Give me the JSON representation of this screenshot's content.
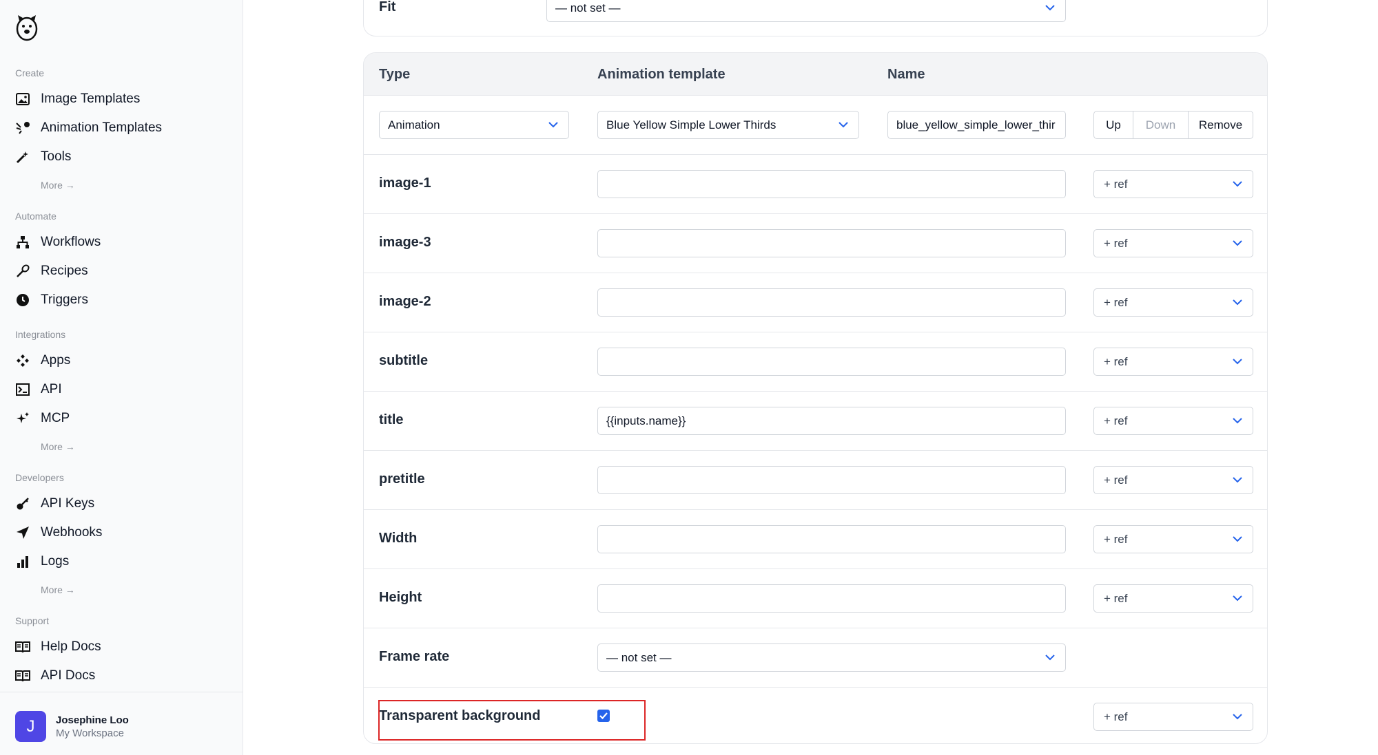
{
  "sidebar": {
    "sections": [
      {
        "label": "Create",
        "items": [
          {
            "label": "Image Templates",
            "icon": "image-icon"
          },
          {
            "label": "Animation Templates",
            "icon": "animation-icon"
          },
          {
            "label": "Tools",
            "icon": "wand-icon"
          }
        ],
        "more": "More →"
      },
      {
        "label": "Automate",
        "items": [
          {
            "label": "Workflows",
            "icon": "workflow-icon"
          },
          {
            "label": "Recipes",
            "icon": "recipe-icon"
          },
          {
            "label": "Triggers",
            "icon": "clock-icon"
          }
        ]
      },
      {
        "label": "Integrations",
        "items": [
          {
            "label": "Apps",
            "icon": "apps-icon"
          },
          {
            "label": "API",
            "icon": "terminal-icon"
          },
          {
            "label": "MCP",
            "icon": "sparkle-icon"
          }
        ],
        "more": "More →"
      },
      {
        "label": "Developers",
        "items": [
          {
            "label": "API Keys",
            "icon": "key-icon"
          },
          {
            "label": "Webhooks",
            "icon": "send-icon"
          },
          {
            "label": "Logs",
            "icon": "bar-chart-icon"
          }
        ],
        "more": "More →"
      },
      {
        "label": "Support",
        "items": [
          {
            "label": "Help Docs",
            "icon": "book-icon"
          },
          {
            "label": "API Docs",
            "icon": "book-icon"
          }
        ]
      }
    ],
    "user": {
      "initial": "J",
      "name": "Josephine Loo",
      "workspace": "My Workspace"
    }
  },
  "fit": {
    "label": "Fit",
    "value": "— not set —"
  },
  "table": {
    "headers": {
      "type": "Type",
      "template": "Animation template",
      "name": "Name"
    },
    "main_row": {
      "type": "Animation",
      "template": "Blue Yellow Simple Lower Thirds",
      "name": "blue_yellow_simple_lower_thir",
      "up": "Up",
      "down": "Down",
      "remove": "Remove"
    },
    "fields": [
      {
        "label": "image-1",
        "value": ""
      },
      {
        "label": "image-3",
        "value": ""
      },
      {
        "label": "image-2",
        "value": ""
      },
      {
        "label": "subtitle",
        "value": ""
      },
      {
        "label": "title",
        "value": "{{inputs.name}}"
      },
      {
        "label": "pretitle",
        "value": ""
      },
      {
        "label": "Width",
        "value": ""
      },
      {
        "label": "Height",
        "value": ""
      }
    ],
    "ref_label": "+ ref",
    "frame_rate": {
      "label": "Frame rate",
      "value": "— not set —"
    },
    "transparent": {
      "label": "Transparent background",
      "checked": true
    }
  },
  "colors": {
    "accent": "#2563eb",
    "highlight": "#dc2626",
    "avatar": "#4f46e5"
  }
}
